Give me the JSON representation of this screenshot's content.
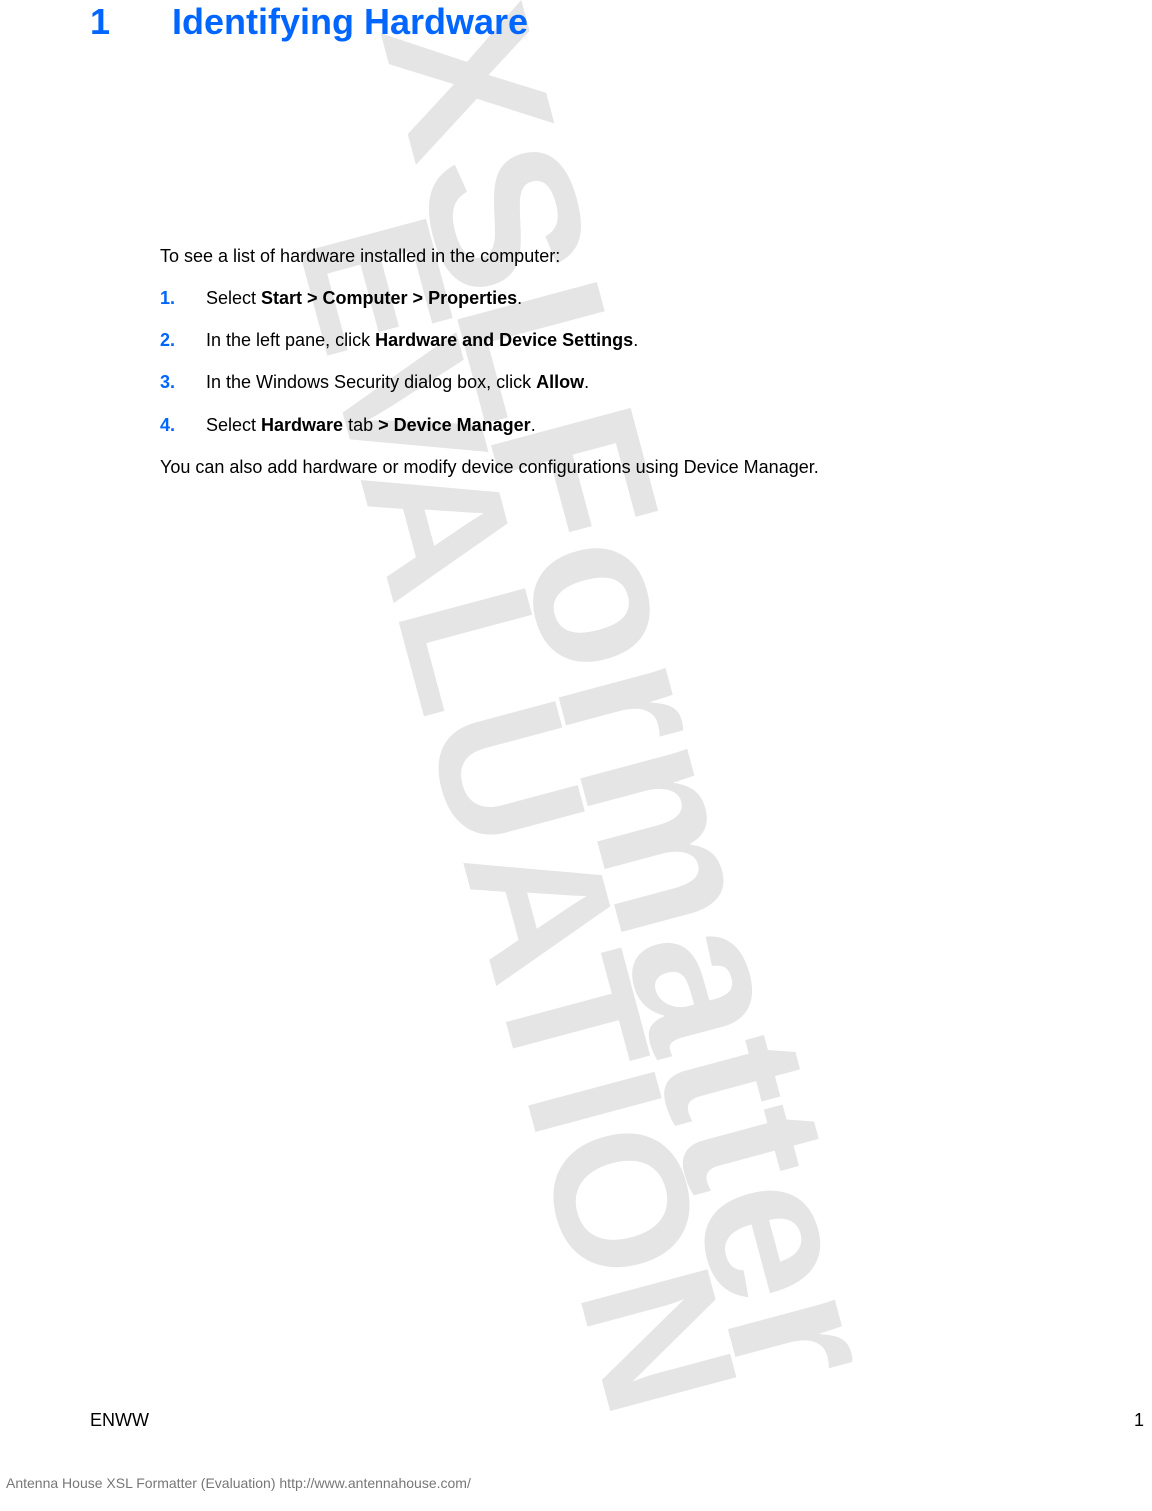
{
  "heading": {
    "chapter_number": "1",
    "title": "Identifying Hardware"
  },
  "content": {
    "intro": "To see a list of hardware installed in the computer:",
    "steps": [
      {
        "num": "1.",
        "pre": "Select ",
        "bold": "Start > Computer > Properties",
        "post": "."
      },
      {
        "num": "2.",
        "pre": "In the left pane, click ",
        "bold": "Hardware and Device Settings",
        "post": "."
      },
      {
        "num": "3.",
        "pre": "In the Windows Security dialog box, click ",
        "bold": "Allow",
        "post": "."
      },
      {
        "num": "4.",
        "pre": "Select ",
        "bold": "Hardware",
        "mid": " tab ",
        "bold2": "> Device Manager",
        "post": "."
      }
    ],
    "closing": "You can also add hardware or modify device configurations using Device Manager."
  },
  "footer": {
    "left": "ENWW",
    "right": "1"
  },
  "credit": "Antenna House XSL Formatter (Evaluation)  http://www.antennahouse.com/",
  "watermark": {
    "line1": "XSLFormatter",
    "line2": "EVALUATION"
  }
}
